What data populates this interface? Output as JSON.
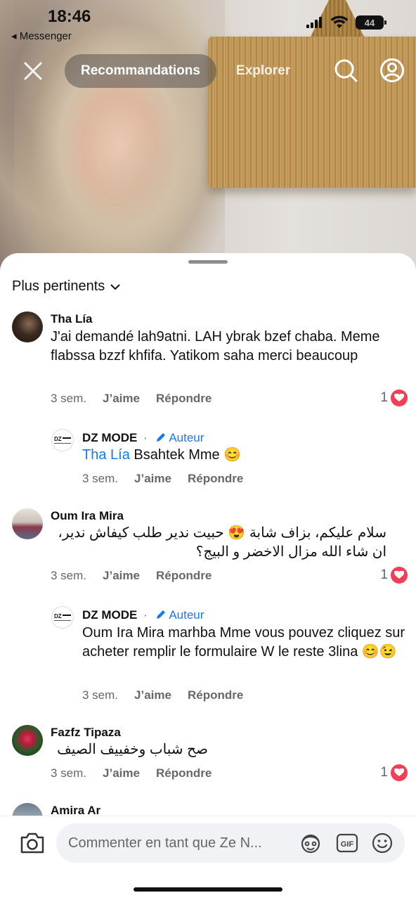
{
  "status_bar": {
    "time": "18:46",
    "back_app": "◂ Messenger",
    "battery": "44"
  },
  "top_nav": {
    "tab_active": "Recommandations",
    "tab_other": "Explorer"
  },
  "sheet": {
    "sort_label": "Plus pertinents"
  },
  "comments": [
    {
      "name": "Tha Lía",
      "text": "J'ai demandé  lah9atni.   LAH ybrak  bzef chaba. Meme flabssa bzzf khfifa.  Yatikom saha    merci beaucoup",
      "time": "3 sem.",
      "like": "J’aime",
      "reply": "Répondre",
      "likes": "1"
    },
    {
      "name": "DZ MODE",
      "sep": "·",
      "author": "Auteur",
      "mention": "Tha Lía",
      "text": " Bsahtek Mme 😊",
      "time": "3 sem.",
      "like": "J’aime",
      "reply": "Répondre"
    },
    {
      "name": "Oum Ira Mira",
      "text": "سلام عليكم، بزاف شابة 😍 حبيت ندير طلب كيفاش ندير، ان شاء الله مزال الاخضر و البيج؟",
      "time": "3 sem.",
      "like": "J’aime",
      "reply": "Répondre",
      "likes": "1"
    },
    {
      "name": "DZ MODE",
      "sep": "·",
      "author": "Auteur",
      "text": "Oum Ira Mira marhba Mme vous pouvez cliquez sur acheter remplir le formulaire W le reste 3lina 😊😉",
      "time": "3 sem.",
      "like": "J’aime",
      "reply": "Répondre"
    },
    {
      "name": "Fazfz Tipaza",
      "text": "صح  شباب وخفييف الصيف",
      "time": "3 sem.",
      "like": "J’aime",
      "reply": "Répondre",
      "likes": "1"
    },
    {
      "name": "Amira Ar"
    }
  ],
  "composer": {
    "placeholder": "Commenter en tant que Ze N..."
  },
  "colors": {
    "accent": "#1877f2",
    "heart": "#f33e58",
    "meta": "#65676b"
  }
}
